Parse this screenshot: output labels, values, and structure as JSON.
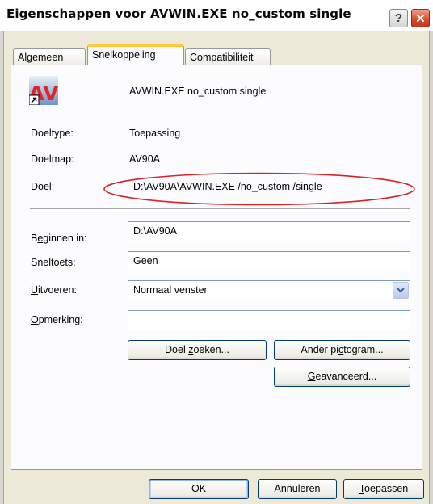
{
  "window": {
    "title": "Eigenschappen voor AVWIN.EXE no_custom single",
    "help_label": "?",
    "close_label": "✕"
  },
  "tabs": [
    {
      "label": "Algemeen",
      "active": false
    },
    {
      "label": "Snelkoppeling",
      "active": true
    },
    {
      "label": "Compatibiliteit",
      "active": false
    }
  ],
  "shortcut": {
    "icon_text": "AV",
    "name": "AVWIN.EXE no_custom single",
    "fields": {
      "target_type": {
        "label": "Doeltype:",
        "value": "Toepassing"
      },
      "target_folder": {
        "label": "Doelmap:",
        "value": "AV90A"
      },
      "target": {
        "label_underlined": "D",
        "label_rest": "oel:",
        "value": "D:\\AV90A\\AVWIN.EXE /no_custom /single"
      },
      "start_in": {
        "label_pre": "B",
        "label_underlined": "e",
        "label_rest": "ginnen in:",
        "value": "D:\\AV90A"
      },
      "shortcut_key": {
        "label_underlined": "S",
        "label_rest": "neltoets:",
        "value": "Geen"
      },
      "run": {
        "label_underlined": "U",
        "label_rest": "itvoeren:",
        "value": "Normaal venster"
      },
      "comment": {
        "label_underlined": "O",
        "label_rest": "pmerking:",
        "value": ""
      }
    },
    "buttons": {
      "find_target": {
        "pre": "Doel ",
        "underlined": "z",
        "rest": "oeken..."
      },
      "change_icon": {
        "pre": "Ander pi",
        "underlined": "c",
        "rest": "togram..."
      },
      "advanced": {
        "pre": "",
        "underlined": "G",
        "rest": "eavanceerd..."
      }
    }
  },
  "footer": {
    "ok_label": "OK",
    "cancel_label": "Annuleren",
    "apply_underlined": "T",
    "apply_rest": "oepassen"
  },
  "colors": {
    "highlight_ellipse": "#d9232a",
    "icon_red": "#e0242a",
    "active_tab_accent": "#ffc83c"
  }
}
